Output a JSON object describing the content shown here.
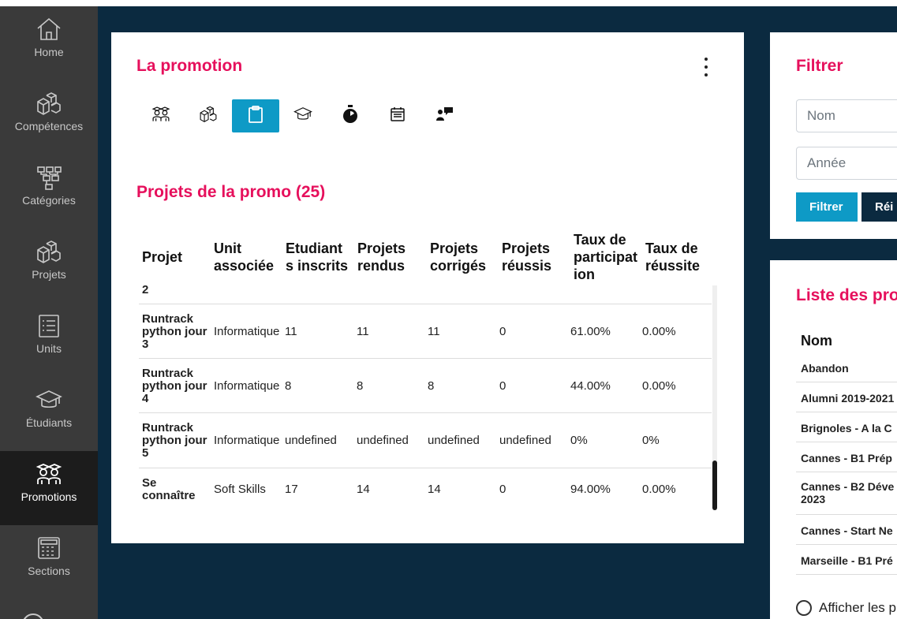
{
  "sidebar": {
    "items": [
      {
        "label": "Home",
        "icon": "home-icon"
      },
      {
        "label": "Compétences",
        "icon": "cubes-icon"
      },
      {
        "label": "Catégories",
        "icon": "hierarchy-icon"
      },
      {
        "label": "Projets",
        "icon": "cubes-icon"
      },
      {
        "label": "Units",
        "icon": "list-icon"
      },
      {
        "label": "Étudiants",
        "icon": "graduation-cap-icon"
      },
      {
        "label": "Promotions",
        "icon": "students-group-icon",
        "active": true
      },
      {
        "label": "Sections",
        "icon": "calculator-icon"
      }
    ]
  },
  "promo": {
    "title": "La promotion",
    "tabs": [
      {
        "icon": "students-group-icon"
      },
      {
        "icon": "cubes-icon"
      },
      {
        "icon": "clipboard-icon",
        "active": true
      },
      {
        "icon": "graduation-cap-icon"
      },
      {
        "icon": "stopwatch-icon"
      },
      {
        "icon": "calendar-icon"
      },
      {
        "icon": "users-chat-icon"
      }
    ],
    "projects_title": "Projets de la promo (25)",
    "table": {
      "headers": [
        "Projet",
        "Unit associée",
        "Etudiants inscrits",
        "Projets rendus",
        "Projets corrigés",
        "Projets réussis",
        "Taux de participation",
        "Taux de réussite"
      ],
      "header_lines": [
        [
          "Projet"
        ],
        [
          "Unit",
          "associée"
        ],
        [
          "Etudiant",
          "s inscrits"
        ],
        [
          "Projets",
          "rendus"
        ],
        [
          "Projets",
          "corrigés"
        ],
        [
          "Projets",
          "réussis"
        ],
        [
          "Taux de",
          "participat",
          "ion"
        ],
        [
          "Taux de",
          "réussite"
        ]
      ],
      "partial_row_text": "2",
      "rows": [
        {
          "name_lines": [
            "Runtrack",
            "python jour",
            "3"
          ],
          "unit": "Informatique",
          "inscrits": "11",
          "rendus": "11",
          "corriges": "11",
          "reussis": "0",
          "participation": "61.00%",
          "reussite": "0.00%"
        },
        {
          "name_lines": [
            "Runtrack",
            "python jour",
            "4"
          ],
          "unit": "Informatique",
          "inscrits": "8",
          "rendus": "8",
          "corriges": "8",
          "reussis": "0",
          "participation": "44.00%",
          "reussite": "0.00%"
        },
        {
          "name_lines": [
            "Runtrack",
            "python jour",
            "5"
          ],
          "unit": "Informatique",
          "inscrits": "undefined",
          "rendus": "undefined",
          "corriges": "undefined",
          "reussis": "undefined",
          "participation": "0%",
          "reussite": "0%"
        },
        {
          "name_lines": [
            "Se",
            "connaître"
          ],
          "unit": "Soft Skills",
          "inscrits": "17",
          "rendus": "14",
          "corriges": "14",
          "reussis": "0",
          "participation": "94.00%",
          "reussite": "0.00%"
        }
      ]
    }
  },
  "filter": {
    "title": "Filtrer",
    "name_placeholder": "Nom",
    "year_placeholder": "Année",
    "filter_label": "Filtrer",
    "reset_label": "Réi"
  },
  "list": {
    "title": "Liste des pro",
    "header": "Nom",
    "items": [
      [
        "Abandon"
      ],
      [
        "Alumni 2019-2021"
      ],
      [
        "Brignoles - A la C"
      ],
      [
        "Cannes - B1 Prép"
      ],
      [
        "Cannes - B2 Déve",
        "2023"
      ],
      [
        "Cannes - Start Ne"
      ],
      [
        "Marseille - B1 Pré"
      ]
    ],
    "show_label": "Afficher les p"
  },
  "colors": {
    "accent_pink": "#e6105c",
    "accent_blue": "#0e9ac6",
    "navy": "#0b2a40",
    "sidebar": "#3a3a3a"
  }
}
